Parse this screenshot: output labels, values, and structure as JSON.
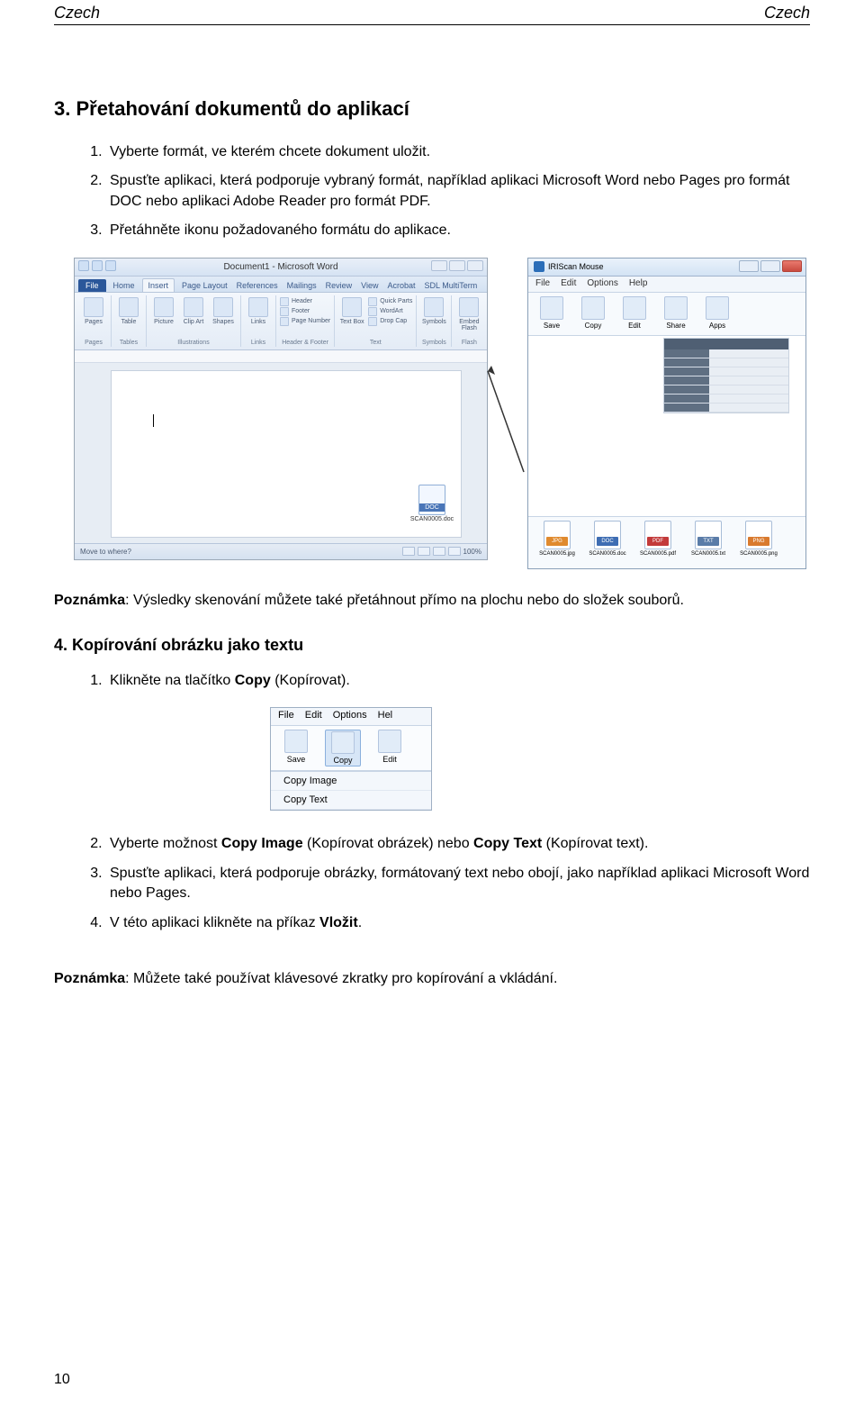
{
  "header": {
    "left": "Czech",
    "right": "Czech"
  },
  "section3": {
    "title": "3. Přetahování dokumentů do aplikací",
    "steps": [
      "Vyberte formát, ve kterém chcete dokument uložit.",
      "Spusťte aplikaci, která podporuje vybraný formát, například aplikaci Microsoft Word nebo Pages pro formát DOC nebo aplikaci Adobe Reader pro formát PDF.",
      "Přetáhněte ikonu požadovaného formátu do aplikace."
    ]
  },
  "word": {
    "title": "Document1 - Microsoft Word",
    "fileTab": "File",
    "tabs": [
      "Home",
      "Insert",
      "Page Layout",
      "References",
      "Mailings",
      "Review",
      "View",
      "Acrobat",
      "SDL MultiTerm"
    ],
    "groups": {
      "pages": "Pages",
      "tables": "Tables",
      "illustrations": "Illustrations",
      "links": "Links",
      "headerfooter": "Header & Footer",
      "text": "Text",
      "symbols": "Symbols",
      "flash": "Flash"
    },
    "big": {
      "pages": "Pages",
      "table": "Table",
      "picture": "Picture",
      "clip": "Clip Art",
      "shapes": "Shapes",
      "links": "Links",
      "textbox": "Text Box",
      "symbols": "Symbols",
      "embed": "Embed Flash"
    },
    "hf": {
      "header": "Header",
      "footer": "Footer",
      "pagenum": "Page Number"
    },
    "txt": {
      "quick": "Quick Parts",
      "wordart": "WordArt",
      "dropcap": "Drop Cap"
    },
    "status_left": "Move to where?",
    "zoom": "100%",
    "drag_label": "SCAN0005.doc"
  },
  "iris": {
    "title": "IRIScan Mouse",
    "menu": [
      "File",
      "Edit",
      "Options",
      "Help"
    ],
    "tools": [
      "Save",
      "Copy",
      "Edit",
      "Share",
      "Apps"
    ],
    "files": [
      {
        "tag": "JPG",
        "cls": "jpg",
        "name": "SCAN0005.jpg"
      },
      {
        "tag": "DOC",
        "cls": "doc",
        "name": "SCAN0005.doc"
      },
      {
        "tag": "PDF",
        "cls": "pdf",
        "name": "SCAN0005.pdf"
      },
      {
        "tag": "TXT",
        "cls": "txt",
        "name": "SCAN0005.txt"
      },
      {
        "tag": "PNG",
        "cls": "png",
        "name": "SCAN0005.png"
      }
    ]
  },
  "note1": {
    "label": "Poznámka",
    "text": ": Výsledky skenování můžete také přetáhnout přímo na plochu nebo do složek souborů."
  },
  "section4": {
    "title": "4. Kopírování obrázku jako textu",
    "step1_pre": "Klikněte na tlačítko ",
    "step1_bold": "Copy",
    "step1_post": " (Kopírovat).",
    "step2_pre": "Vyberte možnost ",
    "step2_b1": "Copy Image",
    "step2_mid1": " (Kopírovat obrázek) nebo ",
    "step2_b2": "Copy Text",
    "step2_mid2": " (Kopírovat text).",
    "step3": "Spusťte aplikaci, která podporuje obrázky, formátovaný text nebo obojí, jako například aplikaci Microsoft Word nebo Pages.",
    "step4_pre": "V této aplikaci klikněte na příkaz ",
    "step4_bold": "Vložit",
    "step4_post": "."
  },
  "copyfig": {
    "menu": [
      "File",
      "Edit",
      "Options",
      "Hel"
    ],
    "tools": [
      "Save",
      "Copy",
      "Edit"
    ],
    "dropdown": [
      "Copy Image",
      "Copy Text"
    ]
  },
  "note2": {
    "label": "Poznámka",
    "text": ": Můžete také používat klávesové zkratky pro kopírování a vkládání."
  },
  "pageNumber": "10"
}
